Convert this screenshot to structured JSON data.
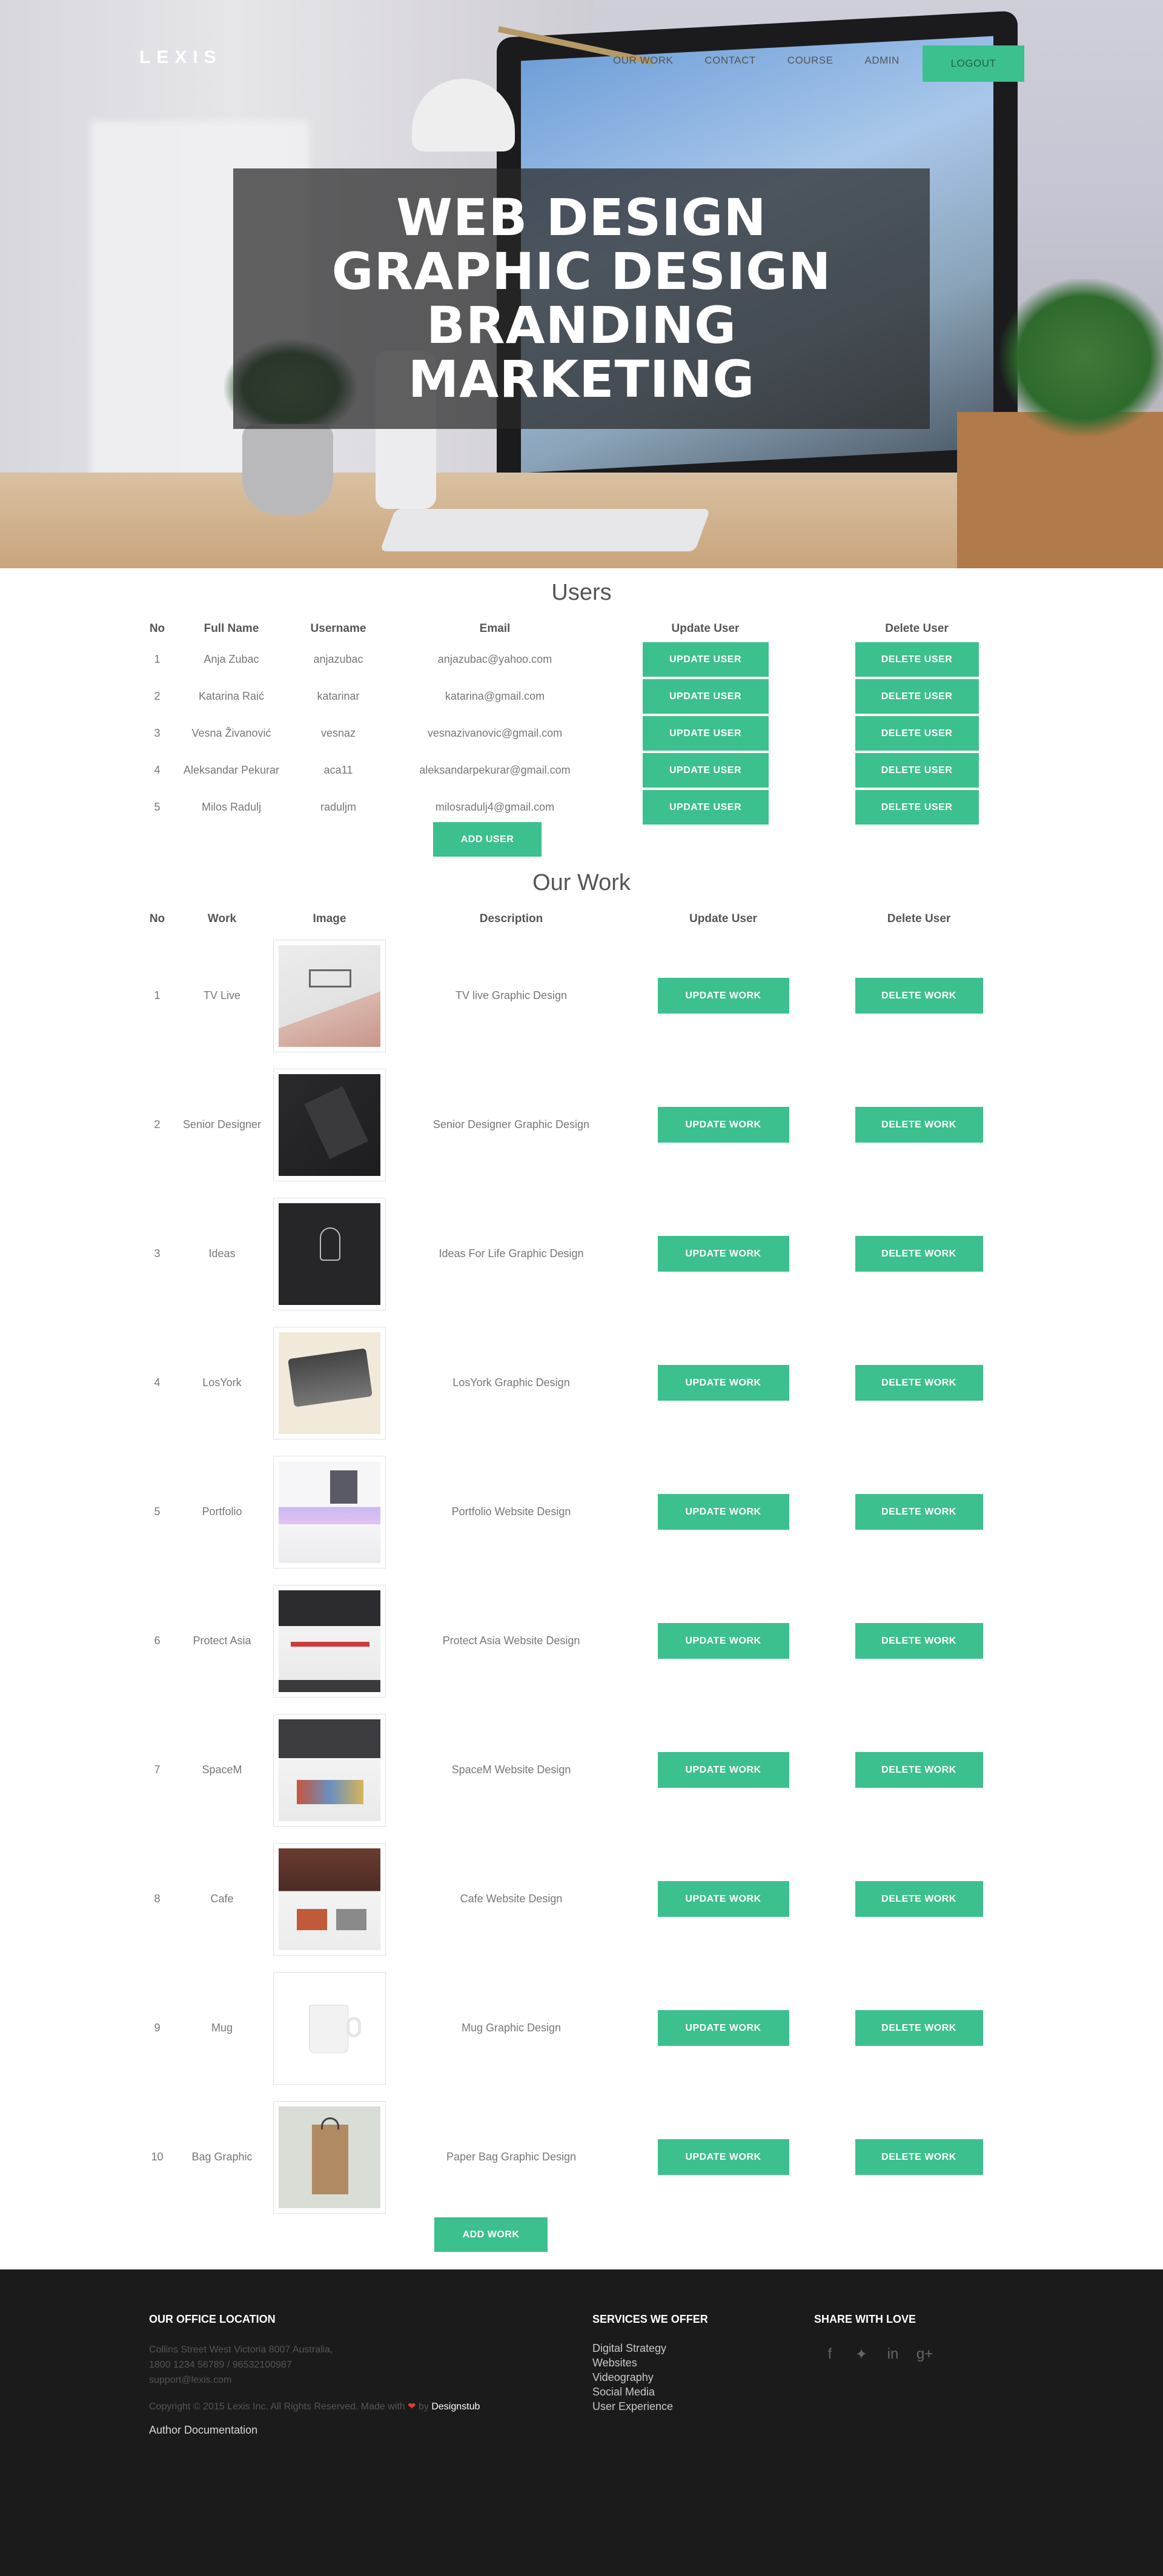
{
  "brand": "LEXIS",
  "nav": {
    "items": [
      "OUR WORK",
      "CONTACT",
      "COURSE",
      "ADMIN"
    ],
    "logout": "LOGOUT"
  },
  "hero": {
    "lines": [
      "WEB DESIGN",
      "GRAPHIC DESIGN",
      "BRANDING",
      "MARKETING"
    ]
  },
  "users": {
    "title": "Users",
    "headers": [
      "No",
      "Full Name",
      "Username",
      "Email",
      "Update User",
      "Delete User"
    ],
    "rows": [
      {
        "no": "1",
        "name": "Anja Zubac",
        "username": "anjazubac",
        "email": "anjazubac@yahoo.com"
      },
      {
        "no": "2",
        "name": "Katarina Raić",
        "username": "katarinar",
        "email": "katarina@gmail.com"
      },
      {
        "no": "3",
        "name": "Vesna Živanović",
        "username": "vesnaz",
        "email": "vesnazivanovic@gmail.com"
      },
      {
        "no": "4",
        "name": "Aleksandar Pekurar",
        "username": "aca11",
        "email": "aleksandarpekurar@gmail.com"
      },
      {
        "no": "5",
        "name": "Milos Radulj",
        "username": "raduljm",
        "email": "milosradulj4@gmail.com"
      }
    ],
    "update_label": "UPDATE USER",
    "delete_label": "DELETE USER",
    "add_label": "ADD USER"
  },
  "work": {
    "title": "Our Work",
    "headers": [
      "No",
      "Work",
      "Image",
      "Description",
      "Update User",
      "Delete User"
    ],
    "rows": [
      {
        "no": "1",
        "work": "TV Live",
        "description": "TV live Graphic Design",
        "image": "tv-live-thumbnail"
      },
      {
        "no": "2",
        "work": "Senior Designer",
        "description": "Senior Designer Graphic Design",
        "image": "senior-designer-thumbnail"
      },
      {
        "no": "3",
        "work": "Ideas",
        "description": "Ideas For Life Graphic Design",
        "image": "ideas-thumbnail"
      },
      {
        "no": "4",
        "work": "LosYork",
        "description": "LosYork Graphic Design",
        "image": "losyork-thumbnail"
      },
      {
        "no": "5",
        "work": "Portfolio",
        "description": "Portfolio Website Design",
        "image": "portfolio-thumbnail"
      },
      {
        "no": "6",
        "work": "Protect Asia",
        "description": "Protect Asia Website Design",
        "image": "protect-asia-thumbnail"
      },
      {
        "no": "7",
        "work": "SpaceM",
        "description": "SpaceM Website Design",
        "image": "spacem-thumbnail"
      },
      {
        "no": "8",
        "work": "Cafe",
        "description": "Cafe Website Design",
        "image": "cafe-thumbnail"
      },
      {
        "no": "9",
        "work": "Mug",
        "description": "Mug Graphic Design",
        "image": "mug-thumbnail"
      },
      {
        "no": "10",
        "work": "Bag Graphic",
        "description": "Paper Bag Graphic Design",
        "image": "bag-graphic-thumbnail"
      }
    ],
    "update_label": "UPDATE WORK",
    "delete_label": "DELETE WORK",
    "add_label": "ADD WORK"
  },
  "footer": {
    "office_title": "OUR OFFICE LOCATION",
    "address": "Collins Street West Victoria 8007 Australia,",
    "phones": "1800 1234 56789 / 96532100987",
    "email": "support@lexis.com",
    "copyright_prefix": "Copyright © 2015 Lexis Inc. All Rights Reserved. Made with",
    "copyright_by": "by",
    "copyright_link": "Designstub",
    "author_doc": "Author Documentation",
    "services_title": "SERVICES WE OFFER",
    "services": [
      "Digital Strategy",
      "Websites",
      "Videography",
      "Social Media",
      "User Experience"
    ],
    "share_title": "SHARE WITH LOVE",
    "social_icons": [
      "facebook-icon",
      "twitter-icon",
      "linkedin-icon",
      "google-plus-icon"
    ]
  },
  "colors": {
    "accent": "#3cc08e",
    "footer_bg": "#1b1b1b",
    "hero_overlay": "#282828"
  }
}
